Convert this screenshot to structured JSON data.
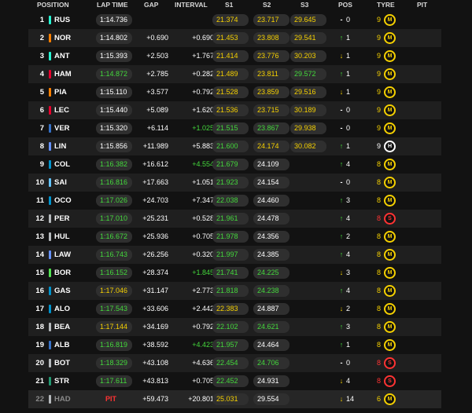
{
  "headers": {
    "position": "POSITION",
    "lap_time": "LAP TIME",
    "gap": "GAP",
    "interval": "INTERVAL",
    "s1": "S1",
    "s2": "S2",
    "s3": "S3",
    "pos": "POS",
    "tyre": "TYRE",
    "pit": "PIT"
  },
  "colors": {
    "yellow": "#f5d000",
    "green": "#44d83c",
    "red": "#ff3333",
    "mercedes": "#27f4d2",
    "mclaren": "#ff8000",
    "ferrari": "#e8002d",
    "red_bull": "#3671c6",
    "alpine": "#0093cc",
    "williams": "#64c4ff",
    "racing_bulls": "#6692ff",
    "sauber": "#52e252",
    "haas": "#b6babd",
    "aston_martin": "#229971"
  },
  "rows": [
    {
      "position": "1",
      "team_color": "#27f4d2",
      "driver": "RUS",
      "lap_time": "1:14.736",
      "lap_color": "p",
      "gap": "",
      "interval": "",
      "interval_color": "w",
      "s1": "21.374",
      "s1_color": "y",
      "s2": "23.717",
      "s2_color": "y",
      "s3": "29.645",
      "s3_color": "y",
      "arrow": "-",
      "arrow_color": "w",
      "pos_change": "0",
      "tyre_laps": "9",
      "tyre_laps_color": "y",
      "tyre": "M",
      "tyre_color": "#f5d000",
      "pit": ""
    },
    {
      "position": "2",
      "team_color": "#ff8000",
      "driver": "NOR",
      "lap_time": "1:14.802",
      "lap_color": "p",
      "gap": "+0.690",
      "interval": "+0.690",
      "interval_color": "w",
      "s1": "21.453",
      "s1_color": "y",
      "s2": "23.808",
      "s2_color": "y",
      "s3": "29.541",
      "s3_color": "y",
      "arrow": "↑",
      "arrow_color": "g",
      "pos_change": "1",
      "tyre_laps": "9",
      "tyre_laps_color": "y",
      "tyre": "M",
      "tyre_color": "#f5d000",
      "pit": ""
    },
    {
      "position": "3",
      "team_color": "#27f4d2",
      "driver": "ANT",
      "lap_time": "1:15.393",
      "lap_color": "p",
      "gap": "+2.503",
      "interval": "+1.767",
      "interval_color": "w",
      "s1": "21.414",
      "s1_color": "y",
      "s2": "23.776",
      "s2_color": "y",
      "s3": "30.203",
      "s3_color": "y",
      "arrow": "↓",
      "arrow_color": "y",
      "pos_change": "1",
      "tyre_laps": "9",
      "tyre_laps_color": "y",
      "tyre": "M",
      "tyre_color": "#f5d000",
      "pit": ""
    },
    {
      "position": "4",
      "team_color": "#e8002d",
      "driver": "HAM",
      "lap_time": "1:14.872",
      "lap_color": "g",
      "gap": "+2.785",
      "interval": "+0.282",
      "interval_color": "w",
      "s1": "21.489",
      "s1_color": "y",
      "s2": "23.811",
      "s2_color": "y",
      "s3": "29.572",
      "s3_color": "g",
      "arrow": "↑",
      "arrow_color": "g",
      "pos_change": "1",
      "tyre_laps": "9",
      "tyre_laps_color": "y",
      "tyre": "M",
      "tyre_color": "#f5d000",
      "pit": ""
    },
    {
      "position": "5",
      "team_color": "#ff8000",
      "driver": "PIA",
      "lap_time": "1:15.110",
      "lap_color": "p",
      "gap": "+3.577",
      "interval": "+0.792",
      "interval_color": "w",
      "s1": "21.528",
      "s1_color": "y",
      "s2": "23.859",
      "s2_color": "y",
      "s3": "29.516",
      "s3_color": "y",
      "arrow": "↓",
      "arrow_color": "y",
      "pos_change": "1",
      "tyre_laps": "9",
      "tyre_laps_color": "y",
      "tyre": "M",
      "tyre_color": "#f5d000",
      "pit": ""
    },
    {
      "position": "6",
      "team_color": "#e8002d",
      "driver": "LEC",
      "lap_time": "1:15.440",
      "lap_color": "p",
      "gap": "+5.089",
      "interval": "+1.620",
      "interval_color": "w",
      "s1": "21.536",
      "s1_color": "y",
      "s2": "23.715",
      "s2_color": "y",
      "s3": "30.189",
      "s3_color": "y",
      "arrow": "-",
      "arrow_color": "w",
      "pos_change": "0",
      "tyre_laps": "9",
      "tyre_laps_color": "y",
      "tyre": "M",
      "tyre_color": "#f5d000",
      "pit": ""
    },
    {
      "position": "7",
      "team_color": "#3671c6",
      "driver": "VER",
      "lap_time": "1:15.320",
      "lap_color": "p",
      "gap": "+6.114",
      "interval": "+1.025",
      "interval_color": "g",
      "s1": "21.515",
      "s1_color": "g",
      "s2": "23.867",
      "s2_color": "g",
      "s3": "29.938",
      "s3_color": "y",
      "arrow": "-",
      "arrow_color": "w",
      "pos_change": "0",
      "tyre_laps": "9",
      "tyre_laps_color": "y",
      "tyre": "M",
      "tyre_color": "#f5d000",
      "pit": ""
    },
    {
      "position": "8",
      "team_color": "#6692ff",
      "driver": "LIN",
      "lap_time": "1:15.856",
      "lap_color": "p",
      "gap": "+11.989",
      "interval": "+5.883",
      "interval_color": "w",
      "s1": "21.600",
      "s1_color": "g",
      "s2": "24.174",
      "s2_color": "y",
      "s3": "30.082",
      "s3_color": "y",
      "arrow": "↑",
      "arrow_color": "g",
      "pos_change": "1",
      "tyre_laps": "9",
      "tyre_laps_color": "w",
      "tyre": "H",
      "tyre_color": "#ffffff",
      "pit": ""
    },
    {
      "position": "9",
      "team_color": "#0093cc",
      "driver": "COL",
      "lap_time": "1:16.382",
      "lap_color": "g",
      "gap": "+16.612",
      "interval": "+4.554",
      "interval_color": "g",
      "s1": "21.679",
      "s1_color": "g",
      "s2": "24.109",
      "s2_color": "p",
      "s3": "",
      "s3_color": "p",
      "arrow": "↑",
      "arrow_color": "g",
      "pos_change": "4",
      "tyre_laps": "8",
      "tyre_laps_color": "y",
      "tyre": "M",
      "tyre_color": "#f5d000",
      "pit": ""
    },
    {
      "position": "10",
      "team_color": "#64c4ff",
      "driver": "SAI",
      "lap_time": "1:16.816",
      "lap_color": "g",
      "gap": "+17.663",
      "interval": "+1.051",
      "interval_color": "w",
      "s1": "21.923",
      "s1_color": "g",
      "s2": "24.154",
      "s2_color": "p",
      "s3": "",
      "s3_color": "p",
      "arrow": "-",
      "arrow_color": "w",
      "pos_change": "0",
      "tyre_laps": "8",
      "tyre_laps_color": "y",
      "tyre": "M",
      "tyre_color": "#f5d000",
      "pit": ""
    },
    {
      "position": "11",
      "team_color": "#0093cc",
      "driver": "OCO",
      "lap_time": "1:17.026",
      "lap_color": "g",
      "gap": "+24.703",
      "interval": "+7.347",
      "interval_color": "w",
      "s1": "22.038",
      "s1_color": "g",
      "s2": "24.460",
      "s2_color": "p",
      "s3": "",
      "s3_color": "p",
      "arrow": "↑",
      "arrow_color": "g",
      "pos_change": "3",
      "tyre_laps": "8",
      "tyre_laps_color": "y",
      "tyre": "M",
      "tyre_color": "#f5d000",
      "pit": ""
    },
    {
      "position": "12",
      "team_color": "#b6babd",
      "driver": "PER",
      "lap_time": "1:17.010",
      "lap_color": "g",
      "gap": "+25.231",
      "interval": "+0.528",
      "interval_color": "w",
      "s1": "21.961",
      "s1_color": "g",
      "s2": "24.478",
      "s2_color": "p",
      "s3": "",
      "s3_color": "p",
      "arrow": "↑",
      "arrow_color": "g",
      "pos_change": "4",
      "tyre_laps": "8",
      "tyre_laps_color": "r",
      "tyre": "S",
      "tyre_color": "#ff3333",
      "pit": ""
    },
    {
      "position": "13",
      "team_color": "#b6babd",
      "driver": "HUL",
      "lap_time": "1:16.672",
      "lap_color": "g",
      "gap": "+25.936",
      "interval": "+0.705",
      "interval_color": "w",
      "s1": "21.978",
      "s1_color": "g",
      "s2": "24.356",
      "s2_color": "p",
      "s3": "",
      "s3_color": "p",
      "arrow": "↑",
      "arrow_color": "g",
      "pos_change": "2",
      "tyre_laps": "8",
      "tyre_laps_color": "y",
      "tyre": "M",
      "tyre_color": "#f5d000",
      "pit": ""
    },
    {
      "position": "14",
      "team_color": "#6692ff",
      "driver": "LAW",
      "lap_time": "1:16.743",
      "lap_color": "g",
      "gap": "+26.256",
      "interval": "+0.320",
      "interval_color": "w",
      "s1": "21.997",
      "s1_color": "g",
      "s2": "24.385",
      "s2_color": "p",
      "s3": "",
      "s3_color": "p",
      "arrow": "↑",
      "arrow_color": "g",
      "pos_change": "4",
      "tyre_laps": "8",
      "tyre_laps_color": "y",
      "tyre": "M",
      "tyre_color": "#f5d000",
      "pit": ""
    },
    {
      "position": "15",
      "team_color": "#52e252",
      "driver": "BOR",
      "lap_time": "1:16.152",
      "lap_color": "g",
      "gap": "+28.374",
      "interval": "+1.845",
      "interval_color": "g",
      "s1": "21.741",
      "s1_color": "g",
      "s2": "24.225",
      "s2_color": "g",
      "s3": "",
      "s3_color": "p",
      "arrow": "↓",
      "arrow_color": "y",
      "pos_change": "3",
      "tyre_laps": "8",
      "tyre_laps_color": "y",
      "tyre": "M",
      "tyre_color": "#f5d000",
      "pit": ""
    },
    {
      "position": "16",
      "team_color": "#0093cc",
      "driver": "GAS",
      "lap_time": "1:17.046",
      "lap_color": "y",
      "gap": "+31.147",
      "interval": "+2.773",
      "interval_color": "w",
      "s1": "21.818",
      "s1_color": "g",
      "s2": "24.238",
      "s2_color": "g",
      "s3": "",
      "s3_color": "p",
      "arrow": "↑",
      "arrow_color": "g",
      "pos_change": "4",
      "tyre_laps": "8",
      "tyre_laps_color": "y",
      "tyre": "M",
      "tyre_color": "#f5d000",
      "pit": ""
    },
    {
      "position": "17",
      "team_color": "#0093cc",
      "driver": "ALO",
      "lap_time": "1:17.543",
      "lap_color": "g",
      "gap": "+33.606",
      "interval": "+2.442",
      "interval_color": "w",
      "s1": "22.383",
      "s1_color": "y",
      "s2": "24.887",
      "s2_color": "p",
      "s3": "",
      "s3_color": "p",
      "arrow": "↓",
      "arrow_color": "y",
      "pos_change": "2",
      "tyre_laps": "8",
      "tyre_laps_color": "y",
      "tyre": "M",
      "tyre_color": "#f5d000",
      "pit": ""
    },
    {
      "position": "18",
      "team_color": "#b6babd",
      "driver": "BEA",
      "lap_time": "1:17.144",
      "lap_color": "y",
      "gap": "+34.169",
      "interval": "+0.792",
      "interval_color": "w",
      "s1": "22.102",
      "s1_color": "g",
      "s2": "24.621",
      "s2_color": "g",
      "s3": "",
      "s3_color": "p",
      "arrow": "↑",
      "arrow_color": "g",
      "pos_change": "3",
      "tyre_laps": "8",
      "tyre_laps_color": "y",
      "tyre": "M",
      "tyre_color": "#f5d000",
      "pit": ""
    },
    {
      "position": "19",
      "team_color": "#3671c6",
      "driver": "ALB",
      "lap_time": "1:16.819",
      "lap_color": "g",
      "gap": "+38.592",
      "interval": "+4.423",
      "interval_color": "g",
      "s1": "21.957",
      "s1_color": "g",
      "s2": "24.464",
      "s2_color": "p",
      "s3": "",
      "s3_color": "p",
      "arrow": "↑",
      "arrow_color": "g",
      "pos_change": "1",
      "tyre_laps": "8",
      "tyre_laps_color": "y",
      "tyre": "M",
      "tyre_color": "#f5d000",
      "pit": ""
    },
    {
      "position": "20",
      "team_color": "#b6babd",
      "driver": "BOT",
      "lap_time": "1:18.329",
      "lap_color": "g",
      "gap": "+43.108",
      "interval": "+4.636",
      "interval_color": "w",
      "s1": "22.454",
      "s1_color": "g",
      "s2": "24.706",
      "s2_color": "g",
      "s3": "",
      "s3_color": "p",
      "arrow": "-",
      "arrow_color": "w",
      "pos_change": "0",
      "tyre_laps": "8",
      "tyre_laps_color": "r",
      "tyre": "S",
      "tyre_color": "#ff3333",
      "pit": ""
    },
    {
      "position": "21",
      "team_color": "#229971",
      "driver": "STR",
      "lap_time": "1:17.611",
      "lap_color": "g",
      "gap": "+43.813",
      "interval": "+0.705",
      "interval_color": "w",
      "s1": "22.452",
      "s1_color": "g",
      "s2": "24.931",
      "s2_color": "p",
      "s3": "",
      "s3_color": "p",
      "arrow": "↓",
      "arrow_color": "y",
      "pos_change": "4",
      "tyre_laps": "8",
      "tyre_laps_color": "r",
      "tyre": "S",
      "tyre_color": "#ff3333",
      "pit": ""
    },
    {
      "position": "22",
      "team_color": "#b6babd",
      "driver": "HAD",
      "lap_time": "PIT",
      "lap_color": "r",
      "gap": "+59.473",
      "interval": "+20.801",
      "interval_color": "w",
      "s1": "25.031",
      "s1_color": "y",
      "s2": "29.554",
      "s2_color": "p",
      "s3": "",
      "s3_color": "p",
      "arrow": "↓",
      "arrow_color": "y",
      "pos_change": "14",
      "tyre_laps": "6",
      "tyre_laps_color": "y",
      "tyre": "M",
      "tyre_color": "#f5d000",
      "pit": "",
      "out": true
    }
  ]
}
